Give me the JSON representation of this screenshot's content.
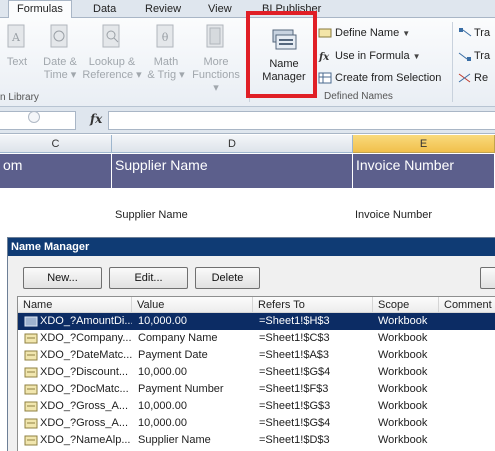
{
  "ribbon_tabs": [
    "Formulas",
    "Data",
    "Review",
    "View",
    "BI Publisher"
  ],
  "function_library": {
    "buttons": [
      {
        "label_1": "Text",
        "label_2": ""
      },
      {
        "label_1": "Date &",
        "label_2": "Time ▾"
      },
      {
        "label_1": "Lookup &",
        "label_2": "Reference ▾"
      },
      {
        "label_1": "Math",
        "label_2": "& Trig ▾"
      },
      {
        "label_1": "More",
        "label_2": "Functions ▾"
      }
    ],
    "group_label": "n Library"
  },
  "defined_names": {
    "name_manager": {
      "label_1": "Name",
      "label_2": "Manager"
    },
    "commands": [
      "Define Name",
      "Use in Formula",
      "Create from Selection"
    ],
    "group_label": "Defined Names"
  },
  "formula_auditing_partial": [
    "Tra",
    "Tra",
    "Re"
  ],
  "formula_bar": {
    "fx": "fx",
    "content": ""
  },
  "columns": [
    "C",
    "D",
    "E"
  ],
  "sheet": {
    "header_cells": [
      "om",
      "Supplier Name",
      "Invoice Number"
    ],
    "value_cells": [
      "Supplier Name",
      "Invoice Number"
    ]
  },
  "dialog": {
    "title": "Name Manager",
    "buttons": [
      "New...",
      "Edit...",
      "Delete"
    ],
    "columns": [
      "Name",
      "Value",
      "Refers To",
      "Scope",
      "Comment"
    ],
    "rows": [
      {
        "name": "XDO_?AmountDi...",
        "value": "10,000.00",
        "refers_to": "=Sheet1!$H$3",
        "scope": "Workbook",
        "comment": ""
      },
      {
        "name": "XDO_?Company...",
        "value": "Company Name",
        "refers_to": "=Sheet1!$C$3",
        "scope": "Workbook",
        "comment": ""
      },
      {
        "name": "XDO_?DateMatc...",
        "value": "Payment Date",
        "refers_to": "=Sheet1!$A$3",
        "scope": "Workbook",
        "comment": ""
      },
      {
        "name": "XDO_?Discount...",
        "value": "10,000.00",
        "refers_to": "=Sheet1!$G$4",
        "scope": "Workbook",
        "comment": ""
      },
      {
        "name": "XDO_?DocMatc...",
        "value": "Payment Number",
        "refers_to": "=Sheet1!$F$3",
        "scope": "Workbook",
        "comment": ""
      },
      {
        "name": "XDO_?Gross_A...",
        "value": "10,000.00",
        "refers_to": "=Sheet1!$G$3",
        "scope": "Workbook",
        "comment": ""
      },
      {
        "name": "XDO_?Gross_A...",
        "value": "10,000.00",
        "refers_to": "=Sheet1!$G$4",
        "scope": "Workbook",
        "comment": ""
      },
      {
        "name": "XDO_?NameAlp...",
        "value": "Supplier Name",
        "refers_to": "=Sheet1!$D$3",
        "scope": "Workbook",
        "comment": ""
      }
    ]
  },
  "colors": {
    "header_purple": "#5c5f8c",
    "selection": "#0c2c64",
    "dialog_title": "#0f3b74",
    "highlight": "#e01f26"
  }
}
